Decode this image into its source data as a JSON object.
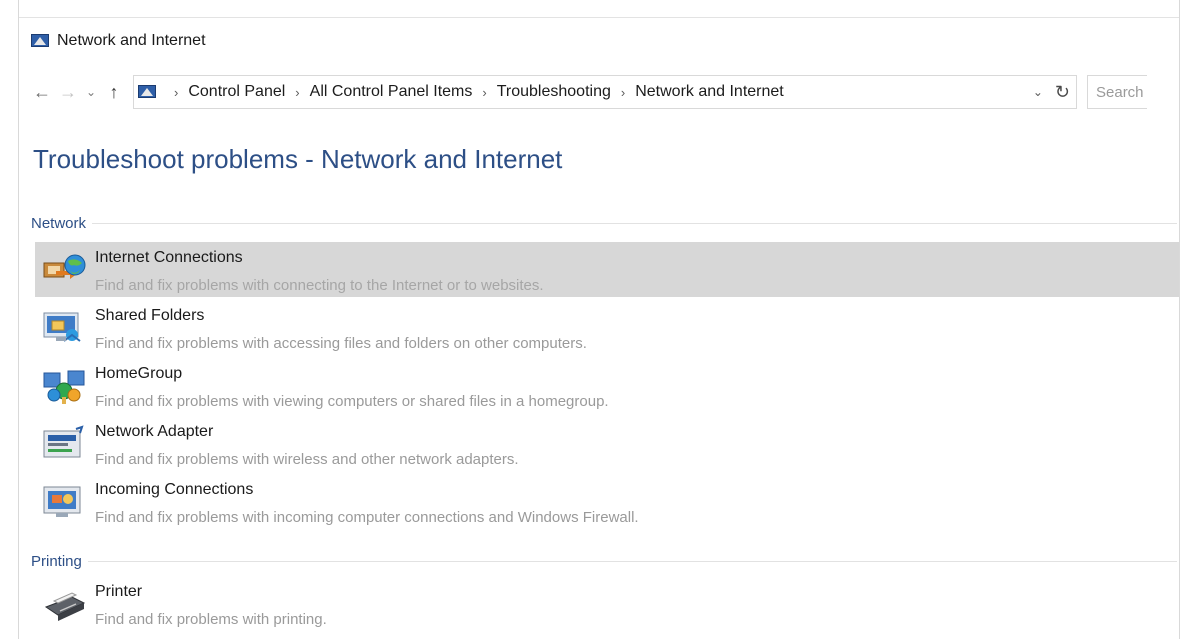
{
  "window": {
    "title": "Network and Internet",
    "title_icon": "control-panel-network-icon"
  },
  "navigation": {
    "back": "←",
    "forward": "→",
    "recent": "⌄",
    "up": "↑",
    "breadcrumb": [
      "Control Panel",
      "All Control Panel Items",
      "Troubleshooting",
      "Network and Internet"
    ],
    "breadcrumb_separator": "›",
    "dropdown": "⌄",
    "refresh": "↻",
    "search_placeholder": "Search Control Panel"
  },
  "page": {
    "heading": "Troubleshoot problems - Network and Internet"
  },
  "sections": [
    {
      "label": "Network",
      "items": [
        {
          "name": "Internet Connections",
          "description": "Find and fix problems with connecting to the Internet or to websites.",
          "icon": "internet-globe-icon",
          "selected": true
        },
        {
          "name": "Shared Folders",
          "description": "Find and fix problems with accessing files and folders on other computers.",
          "icon": "shared-folders-icon",
          "selected": false
        },
        {
          "name": "HomeGroup",
          "description": "Find and fix problems with viewing computers or shared files in a homegroup.",
          "icon": "homegroup-icon",
          "selected": false
        },
        {
          "name": "Network Adapter",
          "description": "Find and fix problems with wireless and other network adapters.",
          "icon": "network-adapter-icon",
          "selected": false
        },
        {
          "name": "Incoming Connections",
          "description": "Find and fix problems with incoming computer connections and Windows Firewall.",
          "icon": "incoming-connections-icon",
          "selected": false
        }
      ]
    },
    {
      "label": "Printing",
      "items": [
        {
          "name": "Printer",
          "description": "Find and fix problems with printing.",
          "icon": "printer-icon",
          "selected": false
        }
      ]
    }
  ],
  "colors": {
    "heading": "#2d4f86",
    "selected_row": "#d7d7d7",
    "description_text": "#9a9a9a"
  }
}
